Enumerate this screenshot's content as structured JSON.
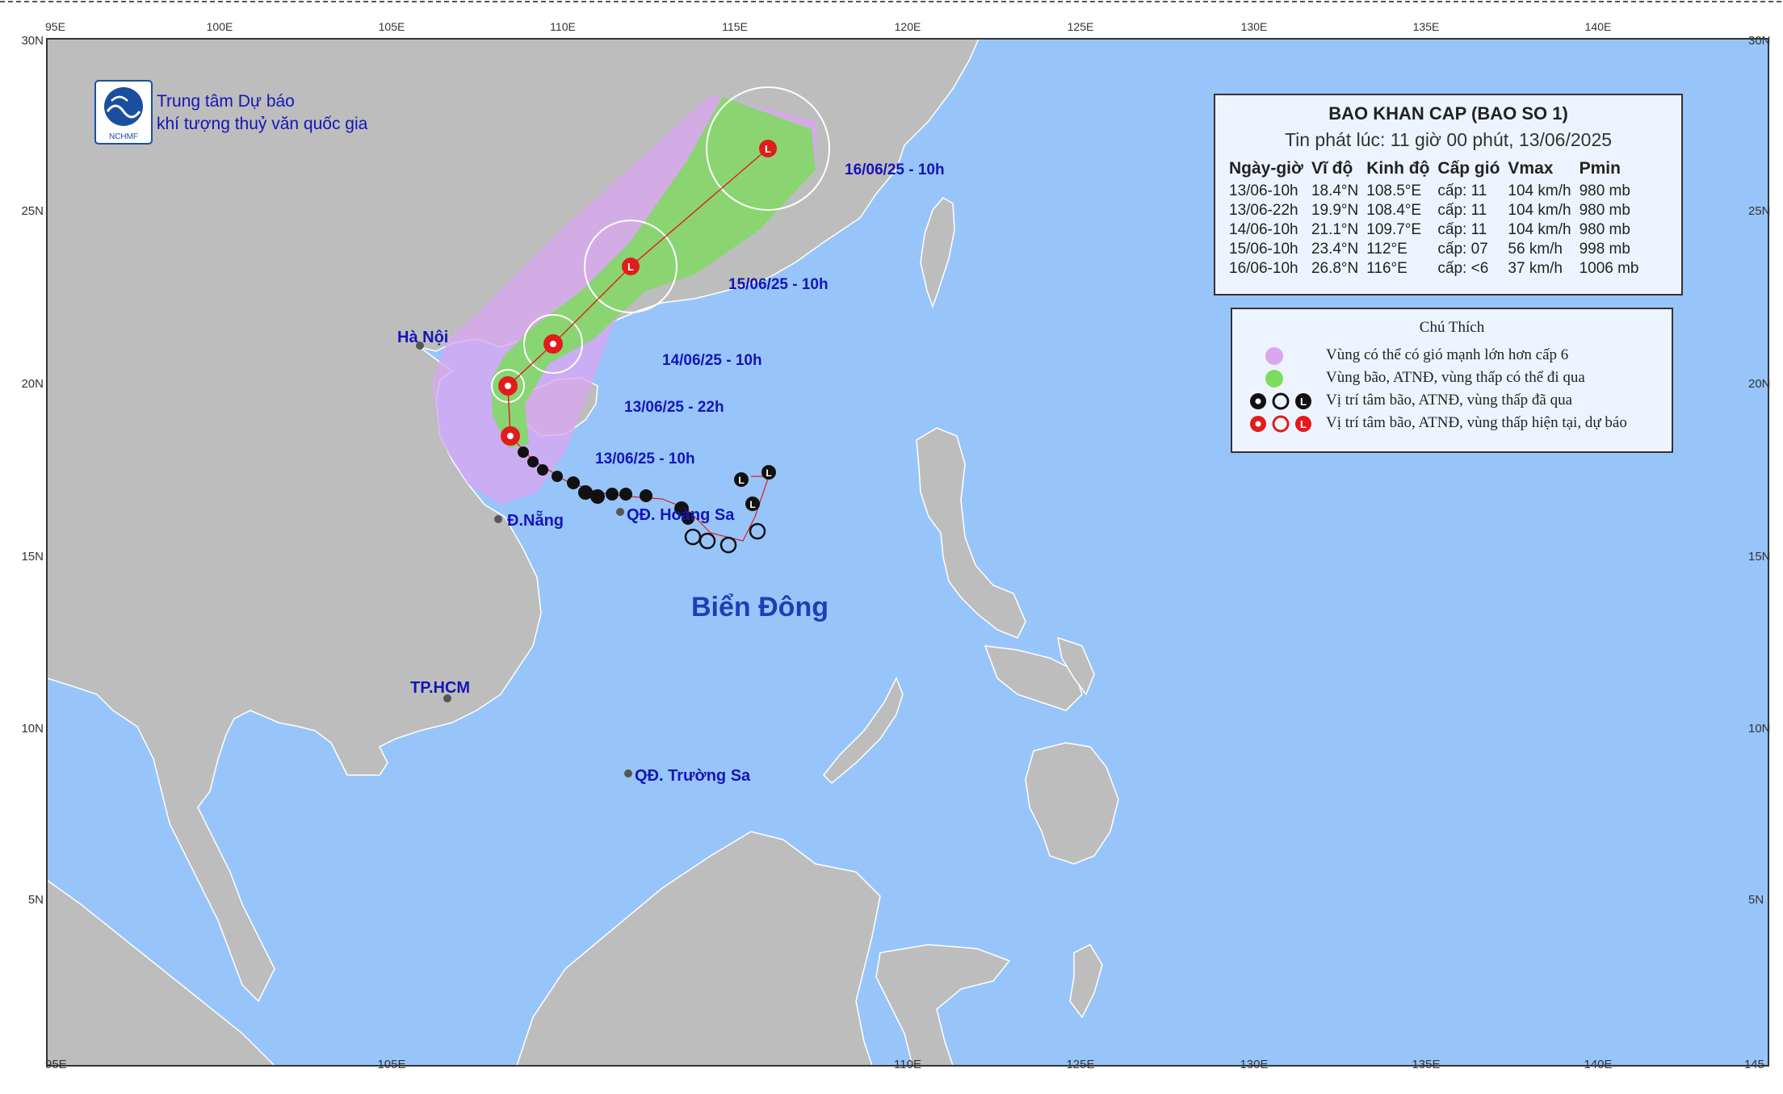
{
  "organization": {
    "line1": "Trung tâm Dự báo",
    "line2": "khí tượng thuỷ văn quốc gia",
    "logo_text": "NCHMF"
  },
  "info_box": {
    "title": "BAO KHAN CAP (BAO SO 1)",
    "issued": "Tin phát lúc: 11 giờ 00 phút, 13/06/2025",
    "headers": [
      "Ngày-giờ",
      "Vĩ độ",
      "Kinh độ",
      "Cấp gió",
      "Vmax",
      "Pmin"
    ],
    "rows": [
      [
        "13/06-10h",
        "18.4°N",
        "108.5°E",
        "cấp: 11",
        "104 km/h",
        "980 mb"
      ],
      [
        "13/06-22h",
        "19.9°N",
        "108.4°E",
        "cấp: 11",
        "104 km/h",
        "980 mb"
      ],
      [
        "14/06-10h",
        "21.1°N",
        "109.7°E",
        "cấp: 11",
        "104 km/h",
        "980 mb"
      ],
      [
        "15/06-10h",
        "23.4°N",
        "112°E",
        "cấp: 07",
        "56 km/h",
        "998 mb"
      ],
      [
        "16/06-10h",
        "26.8°N",
        "116°E",
        "cấp: <6",
        "37 km/h",
        "1006 mb"
      ]
    ]
  },
  "legend": {
    "title": "Chú Thích",
    "items": [
      "Vùng có thể có gió mạnh lớn hơn cấp 6",
      "Vùng bão, ATNĐ, vùng thấp có thể đi qua",
      "Vị trí tâm bão, ATNĐ, vùng thấp đã qua",
      "Vị trí tâm bão, ATNĐ, vùng thấp hiện tại, dự báo"
    ]
  },
  "forecast_labels": [
    "16/06/25 - 10h",
    "15/06/25 - 10h",
    "14/06/25 - 10h",
    "13/06/25 - 22h",
    "13/06/25 - 10h"
  ],
  "places": {
    "hanoi": "Hà Nội",
    "danang": "Đ.Nẵng",
    "hoangsa": "QĐ. Hoàng Sa",
    "hcm": "TP.HCM",
    "truongsa": "QĐ. Trường Sa",
    "sea": "Biển Đông"
  },
  "axes": {
    "top_lon": [
      "95E",
      "100E",
      "105E",
      "110E",
      "115E",
      "120E",
      "125E",
      "130E",
      "135E",
      "140E"
    ],
    "bottom_lon": [
      "95E",
      "105E",
      "110E",
      "125E",
      "130E",
      "135E",
      "140E",
      "145"
    ],
    "lat_left": [
      "30N",
      "25N",
      "20N",
      "15N",
      "10N",
      "5N"
    ],
    "lat_right": [
      "30N",
      "25N",
      "20N",
      "15N",
      "10N",
      "5N"
    ]
  },
  "track": {
    "symbols_current": [
      "storm",
      "storm",
      "storm",
      "low",
      "low"
    ],
    "symbol_letter": "L"
  },
  "colors": {
    "sea": "#97c5fa",
    "land": "#bdbdbd",
    "strong_wind_zone": "#d9a6f0",
    "storm_zone": "#7ddc5e",
    "forecast_red": "#e21b1b",
    "label_blue": "#1515b8"
  }
}
